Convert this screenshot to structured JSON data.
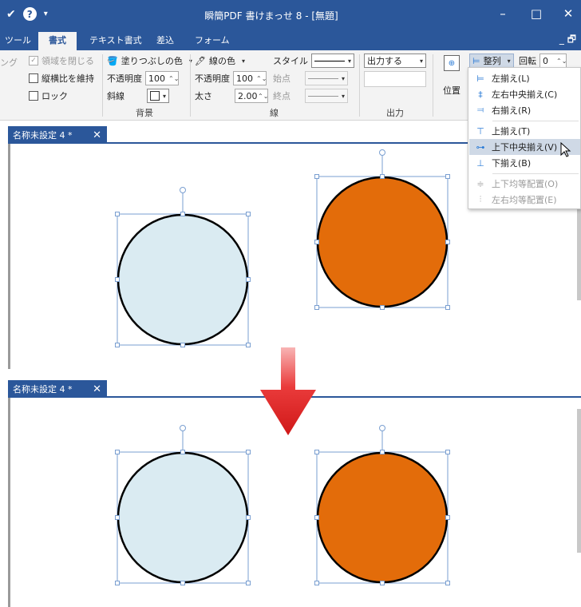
{
  "titlebar": {
    "title": "瞬簡PDF 書けまっせ 8 - [無題]",
    "quick_icons": [
      "checkmark-icon",
      "help-icon",
      "quick-access-menu-icon"
    ],
    "help_label": "?",
    "min_label": "–",
    "max_label": "□",
    "close_label": "✕"
  },
  "tabs": [
    {
      "label": "ツール"
    },
    {
      "label": "書式"
    },
    {
      "label": "テキスト書式"
    },
    {
      "label": "差込"
    },
    {
      "label": "フォーム"
    }
  ],
  "ribbon": {
    "partial_left": "ング",
    "close_region": "領域を閉じる",
    "keep_aspect": "縦横比を維持",
    "lock": "ロック",
    "fill_color": "塗りつぶしの色",
    "fill_opacity_label": "不透明度",
    "fill_opacity_value": "100",
    "hatch_label": "斜線",
    "background_group": "背景",
    "line_color": "線の色",
    "line_opacity_label": "不透明度",
    "line_opacity_value": "100",
    "thickness_label": "太さ",
    "thickness_value": "2.00",
    "style_label": "スタイル",
    "start_label": "始点",
    "end_label": "終点",
    "line_group": "線",
    "output_value": "出力する",
    "output_group": "出力",
    "position_label": "位置",
    "align_label": "整列",
    "rotate_label": "回転",
    "rotate_value": "0"
  },
  "align_menu": [
    {
      "label": "左揃え(L)",
      "icon": "align-left-icon",
      "glyph": "⊨",
      "enabled": true
    },
    {
      "label": "左右中央揃え(C)",
      "icon": "align-horizontal-center-icon",
      "glyph": "‡",
      "enabled": true
    },
    {
      "label": "右揃え(R)",
      "icon": "align-right-icon",
      "glyph": "⫤",
      "enabled": true
    },
    {
      "label": "上揃え(T)",
      "icon": "align-top-icon",
      "glyph": "⊤",
      "enabled": true
    },
    {
      "label": "上下中央揃え(V)",
      "icon": "align-vertical-center-icon",
      "glyph": "⊶",
      "enabled": true
    },
    {
      "label": "下揃え(B)",
      "icon": "align-bottom-icon",
      "glyph": "⊥",
      "enabled": true
    },
    {
      "label": "上下均等配置(O)",
      "icon": "distribute-vertical-icon",
      "glyph": "≑",
      "enabled": false
    },
    {
      "label": "左右均等配置(E)",
      "icon": "distribute-horizontal-icon",
      "glyph": "⫶",
      "enabled": false
    }
  ],
  "documents": [
    {
      "tab_label": "名称未設定 4 *",
      "close": "✕"
    },
    {
      "tab_label": "名称未設定 4 *",
      "close": "✕"
    }
  ],
  "colors": {
    "brand_blue": "#2b579a",
    "circle_light": "#daebf2",
    "circle_orange": "#e36c0a",
    "selection": "#7a9fd1",
    "arrow_red": "#e02020"
  }
}
